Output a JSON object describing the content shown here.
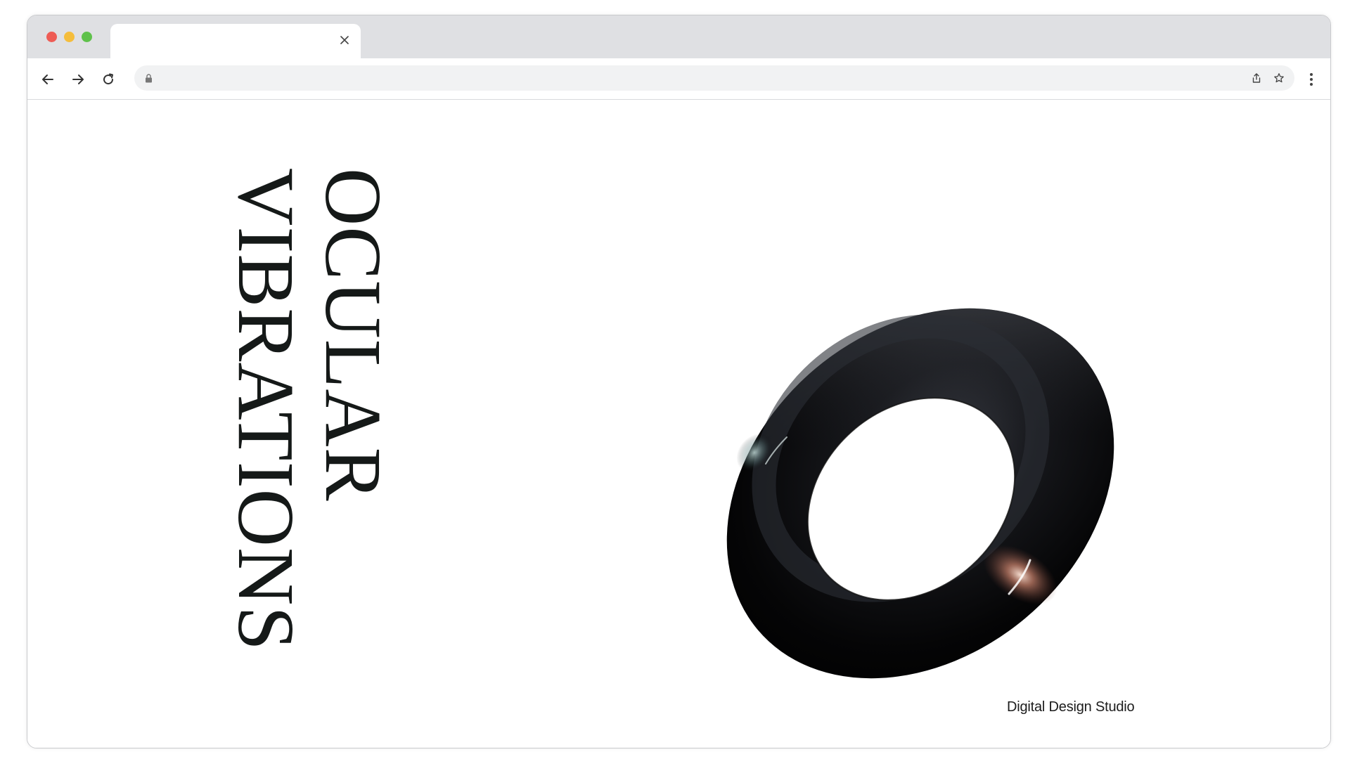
{
  "browser": {
    "tab": {
      "title": "",
      "close_icon": "close-icon"
    },
    "toolbar": {
      "back_icon": "arrow-left-icon",
      "forward_icon": "arrow-right-icon",
      "reload_icon": "reload-icon",
      "address": {
        "lock_icon": "lock-icon",
        "url": ""
      },
      "share_icon": "share-icon",
      "bookmark_icon": "star-icon",
      "menu_icon": "kebab-menu-icon"
    },
    "colors": {
      "titlebar": "#dfe0e3",
      "omnibox": "#f1f2f3",
      "traffic_red": "#ee5c55",
      "traffic_yellow": "#f5bd3b",
      "traffic_green": "#5fc14b"
    }
  },
  "page": {
    "title_line1": "OCULAR",
    "title_line2": "VIBRATIONS",
    "tagline": "Digital Design Studio",
    "hero_object": "black-glossy-torus",
    "text_color": "#151918"
  }
}
